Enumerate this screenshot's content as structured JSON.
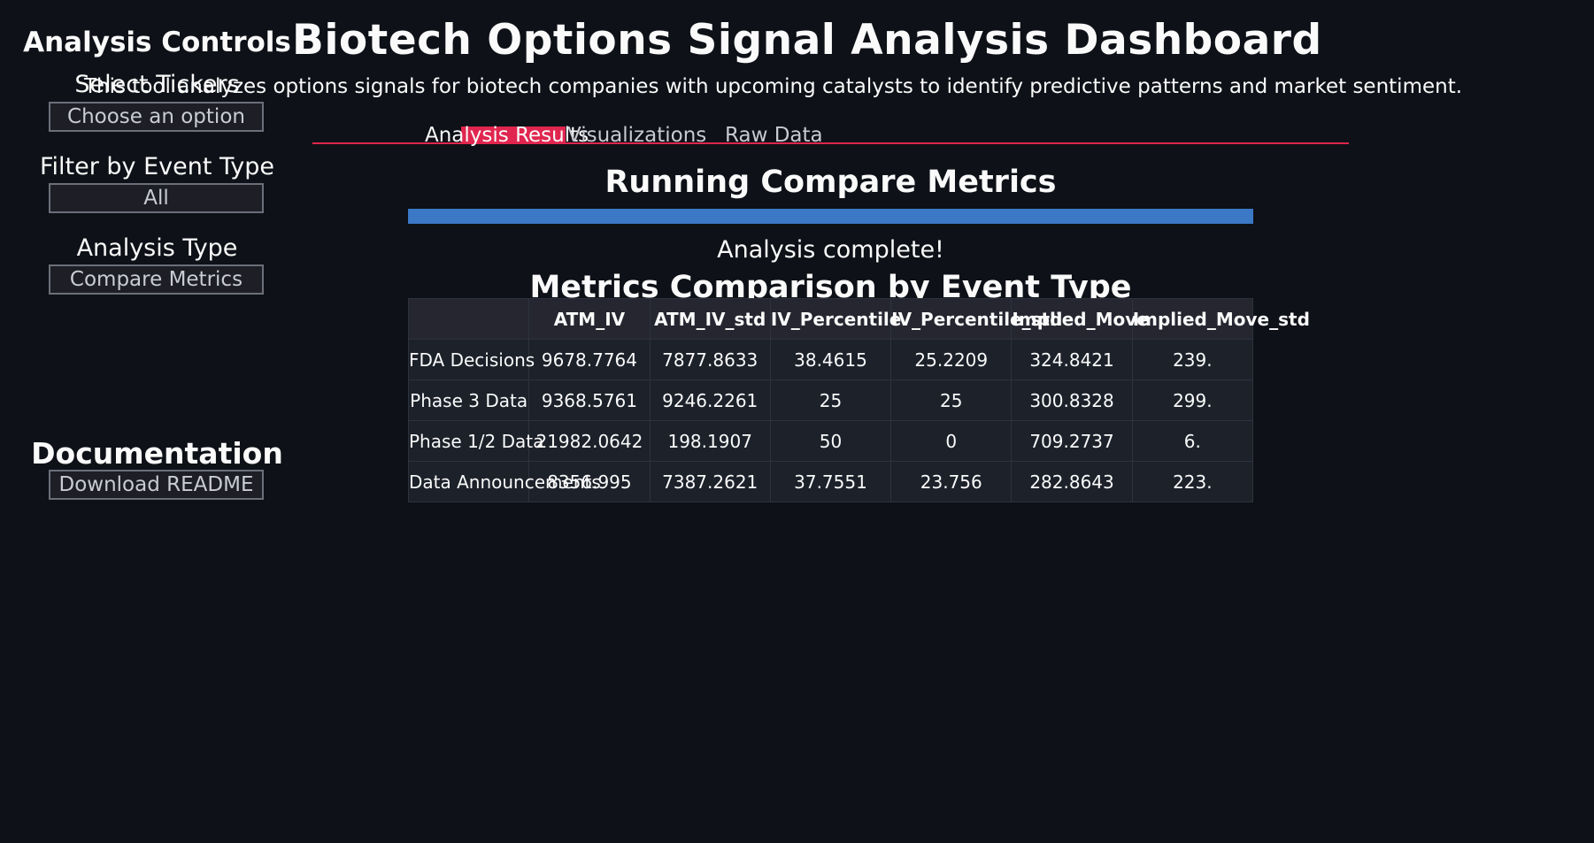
{
  "sidebar": {
    "title": "Analysis Controls",
    "select_tickers_label": "Select Tickers",
    "select_tickers_placeholder": "Choose an option",
    "event_type_label": "Filter by Event Type",
    "event_type_value": "All",
    "analysis_type_label": "Analysis Type",
    "analysis_type_value": "Compare Metrics",
    "documentation_title": "Documentation",
    "download_button": "Download README"
  },
  "main": {
    "title": "Biotech Options Signal Analysis Dashboard",
    "intro": "This tool analyzes options signals for biotech companies with upcoming catalysts to identify predictive patterns and market sentiment.",
    "tabs": [
      {
        "label": "Analysis Results",
        "active": true
      },
      {
        "label": "Visualizations",
        "active": false
      },
      {
        "label": "Raw Data",
        "active": false
      }
    ],
    "running_header": "Running Compare Metrics",
    "progress": 1.0,
    "status_text": "Analysis complete!",
    "table_title": "Metrics Comparison by Event Type",
    "table": {
      "columns": [
        "ATM_IV",
        "ATM_IV_std",
        "IV_Percentile",
        "IV_Percentile_std",
        "Implied_Move",
        "Implied_Move_std"
      ],
      "rows": [
        {
          "label": "FDA Decisions",
          "values": [
            "9678.7764",
            "7877.8633",
            "38.4615",
            "25.2209",
            "324.8421",
            "239."
          ]
        },
        {
          "label": "Phase 3 Data",
          "values": [
            "9368.5761",
            "9246.2261",
            "25",
            "25",
            "300.8328",
            "299."
          ]
        },
        {
          "label": "Phase 1/2 Data",
          "values": [
            "21982.0642",
            "198.1907",
            "50",
            "0",
            "709.2737",
            "6."
          ]
        },
        {
          "label": "Data Announcements",
          "values": [
            "8356.995",
            "7387.2621",
            "37.7551",
            "23.756",
            "282.8643",
            "223."
          ]
        }
      ]
    }
  },
  "colors": {
    "background": "#0e1117",
    "accent": "#e0264f",
    "progress": "#3b78c5"
  }
}
